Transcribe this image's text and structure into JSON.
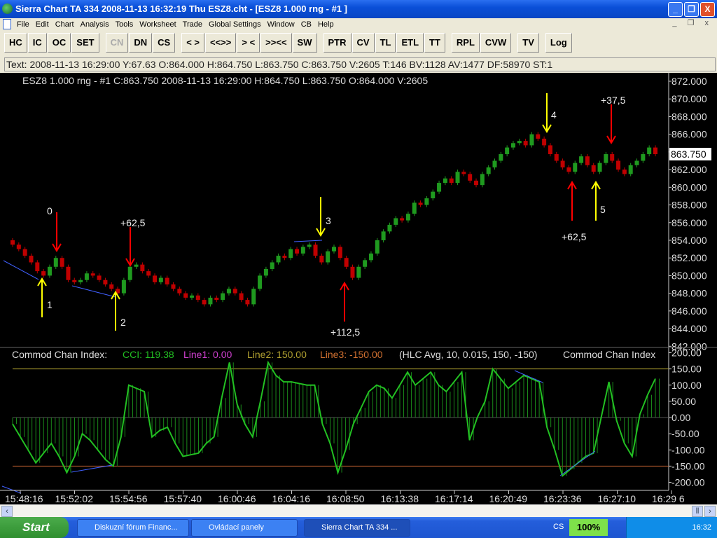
{
  "window": {
    "title": "Sierra Chart TA 334  2008-11-13  16:32:19  Thu   ESZ8.cht - [ESZ8  1.000 rng - #1 ]",
    "min": "_",
    "max": "❐",
    "close": "X"
  },
  "menu": [
    "File",
    "Edit",
    "Chart",
    "Analysis",
    "Tools",
    "Worksheet",
    "Trade",
    "Global Settings",
    "Window",
    "CB",
    "Help"
  ],
  "toolbar": [
    "HC",
    "IC",
    "OC",
    "SET",
    "CN",
    "DN",
    "CS",
    "< >",
    "<<>>",
    "> <",
    ">><<",
    "SW",
    "PTR",
    "CV",
    "TL",
    "ETL",
    "TT",
    "RPL",
    "CVW",
    "TV",
    "Log"
  ],
  "info": "Text: 2008-11-13  16:29:00  Y:67.63  O:864.000  H:864.750  L:863.750  C:863.750  V:2605  T:146  BV:1128  AV:1477  DF:58970  ST:1",
  "price_header": "ESZ8  1.000 rng - #1  C:863.750  2008-11-13  16:29:00  H:864.750  L:863.750  O:864.000  V:2605",
  "cci_header": {
    "name": "Commod Chan Index:",
    "cci": "CCI: 119.38",
    "line1": "Line1: 0.00",
    "line2": "Line2: 150.00",
    "line3": "Line3: -150.00",
    "params": "(HLC Avg, 10, 0.015, 150, -150)",
    "name2": "Commod Chan Index"
  },
  "colors": {
    "up": "#1f9a1f",
    "down": "#c00000",
    "cci": "#22c022",
    "line2": "#b0a030",
    "line3": "#c06030",
    "trend": "#4060ff"
  },
  "chart_data": [
    {
      "type": "candlestick",
      "title": "ESZ8 1.000 rng",
      "ylim": [
        842,
        872
      ],
      "yticks": [
        "872.000",
        "870.000",
        "868.000",
        "866.000",
        "864.000",
        "862.000",
        "860.000",
        "858.000",
        "856.000",
        "854.000",
        "852.000",
        "850.000",
        "848.000",
        "846.000",
        "844.000",
        "842.000"
      ],
      "last_price": "863.750",
      "closes": [
        853.5,
        853,
        852.25,
        851.5,
        850.5,
        850,
        851,
        852,
        851,
        849.5,
        849.25,
        849.5,
        850.25,
        850,
        849.5,
        849,
        848.5,
        848,
        849.5,
        851,
        851.25,
        850.5,
        850,
        849.25,
        849.75,
        849,
        848.5,
        848,
        847.5,
        847.75,
        847.25,
        846.75,
        847.5,
        847.25,
        848,
        848.5,
        848,
        847.25,
        846.75,
        848.5,
        850,
        850.75,
        851.5,
        852.25,
        852,
        853,
        852.5,
        853.25,
        853.5,
        852.25,
        851.5,
        852.75,
        853.25,
        852,
        851,
        849.75,
        851,
        851.75,
        852.5,
        854,
        855,
        855.75,
        856.5,
        856.25,
        857,
        858.25,
        858,
        858.75,
        859.5,
        860.5,
        861,
        860.5,
        861.75,
        861.5,
        860.75,
        860.25,
        861.5,
        862.25,
        863,
        863.75,
        864.5,
        865,
        865.25,
        864.75,
        866,
        865.5,
        864.75,
        863.75,
        863,
        862.25,
        861.75,
        862.75,
        863.5,
        862.5,
        861.75,
        862.75,
        863.75,
        863,
        862,
        861.5,
        862.5,
        863,
        863.75,
        864.5,
        863.75
      ],
      "annotations": [
        {
          "label": "0"
        },
        {
          "label": "1"
        },
        {
          "label": "+62,5"
        },
        {
          "label": "2"
        },
        {
          "label": "3"
        },
        {
          "label": "+112,5"
        },
        {
          "label": "4"
        },
        {
          "label": "+37,5"
        },
        {
          "label": "+62,5"
        },
        {
          "label": "5"
        }
      ]
    },
    {
      "type": "line",
      "title": "Commod Chan Index",
      "ylim": [
        -200,
        200
      ],
      "yticks": [
        "200.00",
        "150.00",
        "100.00",
        "50.00",
        "0.00",
        "-50.00",
        "-100.00",
        "-150.00",
        "-200.00"
      ],
      "levels": [
        150,
        0,
        -150
      ],
      "values": [
        -20,
        -60,
        -100,
        -140,
        -110,
        -80,
        -120,
        -170,
        -120,
        -50,
        -70,
        -100,
        -130,
        -150,
        -60,
        100,
        90,
        80,
        -60,
        -40,
        -30,
        -80,
        -120,
        -115,
        -110,
        -80,
        -60,
        60,
        170,
        40,
        -20,
        -60,
        50,
        170,
        130,
        110,
        110,
        105,
        100,
        100,
        -20,
        -80,
        -170,
        -100,
        -20,
        30,
        80,
        100,
        90,
        60,
        100,
        140,
        100,
        120,
        140,
        100,
        80,
        110,
        140,
        -70,
        0,
        50,
        150,
        120,
        90,
        110,
        130,
        120,
        110,
        -30,
        -100,
        -180,
        -160,
        -140,
        -120,
        -110,
        0,
        110,
        -10,
        -80,
        -120,
        10,
        70,
        120
      ]
    },
    {
      "type": "time-axis",
      "ticks": [
        "15:48:16",
        "15:52:02",
        "15:54:56",
        "15:57:40",
        "16:00:46",
        "16:04:16",
        "16:08:50",
        "16:13:38",
        "16:17:14",
        "16:20:49",
        "16:23:36",
        "16:27:10",
        "16:29 6"
      ]
    }
  ],
  "taskbar": {
    "start": "Start",
    "items": [
      "Diskuzní fórum Financ...",
      "Ovládací panely",
      "Sierra Chart TA 334  ..."
    ],
    "lang": "CS",
    "battery": "100%",
    "clock": "16:32"
  }
}
